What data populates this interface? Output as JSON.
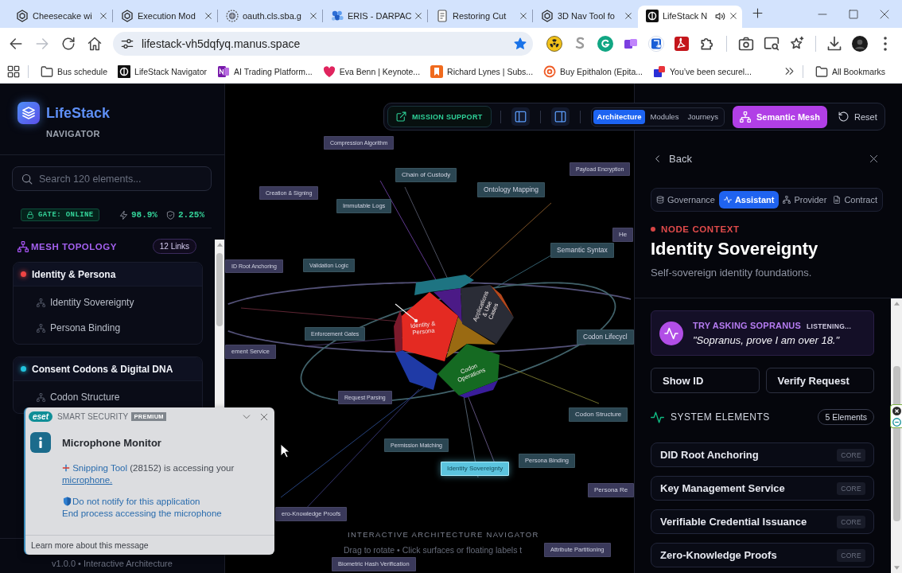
{
  "browser": {
    "tabs": [
      {
        "title": "Cheesecake wi",
        "selected": false,
        "audible": false
      },
      {
        "title": "Execution Mod",
        "selected": false,
        "audible": false
      },
      {
        "title": "oauth.cls.sba.g",
        "selected": false,
        "audible": false
      },
      {
        "title": "ERIS - DARPAC",
        "selected": false,
        "audible": false
      },
      {
        "title": "Restoring Cut",
        "selected": false,
        "audible": false
      },
      {
        "title": "3D Nav Tool fo",
        "selected": false,
        "audible": false
      },
      {
        "title": "LifeStack N",
        "selected": true,
        "audible": true
      }
    ],
    "forward_disabled": true,
    "url": "lifestack-vh5dqfyq.manus.space",
    "bookmarked": true,
    "bookmarks": [
      {
        "title": "Bus schedule"
      },
      {
        "title": "LifeStack Navigator"
      },
      {
        "title": "AI Trading Platform..."
      },
      {
        "title": "Eva Benn | Keynote..."
      },
      {
        "title": "Richard Lynes | Subs..."
      },
      {
        "title": "Buy Epithalon (Epita..."
      },
      {
        "title": "You’ve been securel..."
      }
    ],
    "all_bookmarks": "All Bookmarks"
  },
  "sidebar": {
    "brand": "LifeStack",
    "subtitle": "NAVIGATOR",
    "search": {
      "placeholder": "Search 120 elements..."
    },
    "gate": "GATE: ONLINE",
    "uptime": "98.9%",
    "risk": "2.25%",
    "topology": {
      "title": "MESH TOPOLOGY",
      "badge": "12 Links"
    },
    "groups": [
      {
        "name": "Identity & Persona",
        "color": "#ef4444",
        "children": [
          {
            "name": "Identity Sovereignty"
          },
          {
            "name": "Persona Binding"
          }
        ]
      },
      {
        "name": "Consent Codons & Digital DNA",
        "color": "#22c3dd",
        "children": [
          {
            "name": "Codon Structure"
          }
        ]
      }
    ],
    "footer": "v1.0.0 • Interactive Architecture"
  },
  "toolbar": {
    "mission": "MISSION SUPPORT",
    "panel_toggles": [
      {
        "on": true
      },
      {
        "on": true
      }
    ],
    "views": [
      {
        "label": "Architecture",
        "selected": true
      },
      {
        "label": "Modules",
        "selected": false
      },
      {
        "label": "Journeys",
        "selected": false
      }
    ],
    "mesh": {
      "label": "Semantic Mesh",
      "on": true
    },
    "reset": "Reset"
  },
  "canvas": {
    "labels": [
      {
        "text": "Compression Algorithm",
        "color": "#3a395a",
        "selected": false
      },
      {
        "text": "Payload Encryption",
        "color": "#3a395a",
        "selected": false
      },
      {
        "text": "Chain of Custody",
        "color": "#2b4652",
        "selected": false
      },
      {
        "text": "Ontology Mapping",
        "color": "#2b4652",
        "selected": false
      },
      {
        "text": "Creation & Signing",
        "color": "#3a395a",
        "selected": false
      },
      {
        "text": "Immutable Logs",
        "color": "#2b4652",
        "selected": false
      },
      {
        "text": "He",
        "color": "#3a395a",
        "selected": false
      },
      {
        "text": "Semantic Syntax",
        "color": "#2b4652",
        "selected": false
      },
      {
        "text": "ID Root Anchoring",
        "color": "#3a395a",
        "selected": false
      },
      {
        "text": "Validation Logic",
        "color": "#2b4652",
        "selected": false
      },
      {
        "text": "Enforcement Gates",
        "color": "#2b4652",
        "selected": false
      },
      {
        "text": "ement Service",
        "color": "#3a395a",
        "selected": false
      },
      {
        "text": "Codon Lifecycl",
        "color": "#2b4652",
        "selected": false
      },
      {
        "text": "Request Parsing",
        "color": "#3a395a",
        "selected": false
      },
      {
        "text": "Codon Structure",
        "color": "#2b4652",
        "selected": false
      },
      {
        "text": "Permission Matching",
        "color": "#2b4652",
        "selected": false
      },
      {
        "text": "Persona Binding",
        "color": "#2b4652",
        "selected": false
      },
      {
        "text": "Identity Sovereignty",
        "color": "#5bc4de",
        "selected": true
      },
      {
        "text": "Persona Re",
        "color": "#3a395a",
        "selected": false
      },
      {
        "text": "ero-Knowledge Proofs",
        "color": "#3a395a",
        "selected": false
      },
      {
        "text": "Attribute Partitioning",
        "color": "#3a395a",
        "selected": false
      },
      {
        "text": "Biometric Hash Verification",
        "color": "#3a395a",
        "selected": false
      }
    ],
    "faces": [
      {
        "label": "Identity & Persona",
        "color": "#e42a22"
      },
      {
        "label": "Applications & Use Cases",
        "color": "#2a2c36"
      },
      {
        "label": "Codon Operations",
        "color": "#156a22"
      }
    ],
    "title": "INTERACTIVE ARCHITECTURE NAVIGATOR",
    "hint": "Drag to rotate • Click surfaces or floating labels t"
  },
  "panel": {
    "back": "Back",
    "tabs": [
      {
        "label": "Governance",
        "selected": false
      },
      {
        "label": "Assistant",
        "selected": true
      },
      {
        "label": "Provider",
        "selected": false
      },
      {
        "label": "Contract",
        "selected": false
      }
    ],
    "context": "NODE CONTEXT",
    "title": "Identity Sovereignty",
    "description": "Self-sovereign identity foundations.",
    "assistant": {
      "title": "TRY ASKING SOPRANUS",
      "status": "LISTENING...",
      "prompt": "\"Sopranus, prove I am over 18.\""
    },
    "actions": [
      "Show ID",
      "Verify Request"
    ],
    "elements_title": "SYSTEM ELEMENTS",
    "elements_count": "5 Elements",
    "elements": [
      {
        "name": "DID Root Anchoring",
        "tag": "CORE"
      },
      {
        "name": "Key Management Service",
        "tag": "CORE"
      },
      {
        "name": "Verifiable Credential Issuance",
        "tag": "CORE"
      },
      {
        "name": "Zero-Knowledge Proofs",
        "tag": "CORE"
      }
    ]
  },
  "notification": {
    "brand": "eset",
    "product": "SMART SECURITY",
    "edition": "PREMIUM",
    "title": "Microphone Monitor",
    "app": "Snipping Tool",
    "message": "(28152) is accessing your",
    "link": "microphone.",
    "actions": [
      "Do not notify for this application",
      "End process accessing the microphone"
    ],
    "footer": "Learn more about this message"
  }
}
